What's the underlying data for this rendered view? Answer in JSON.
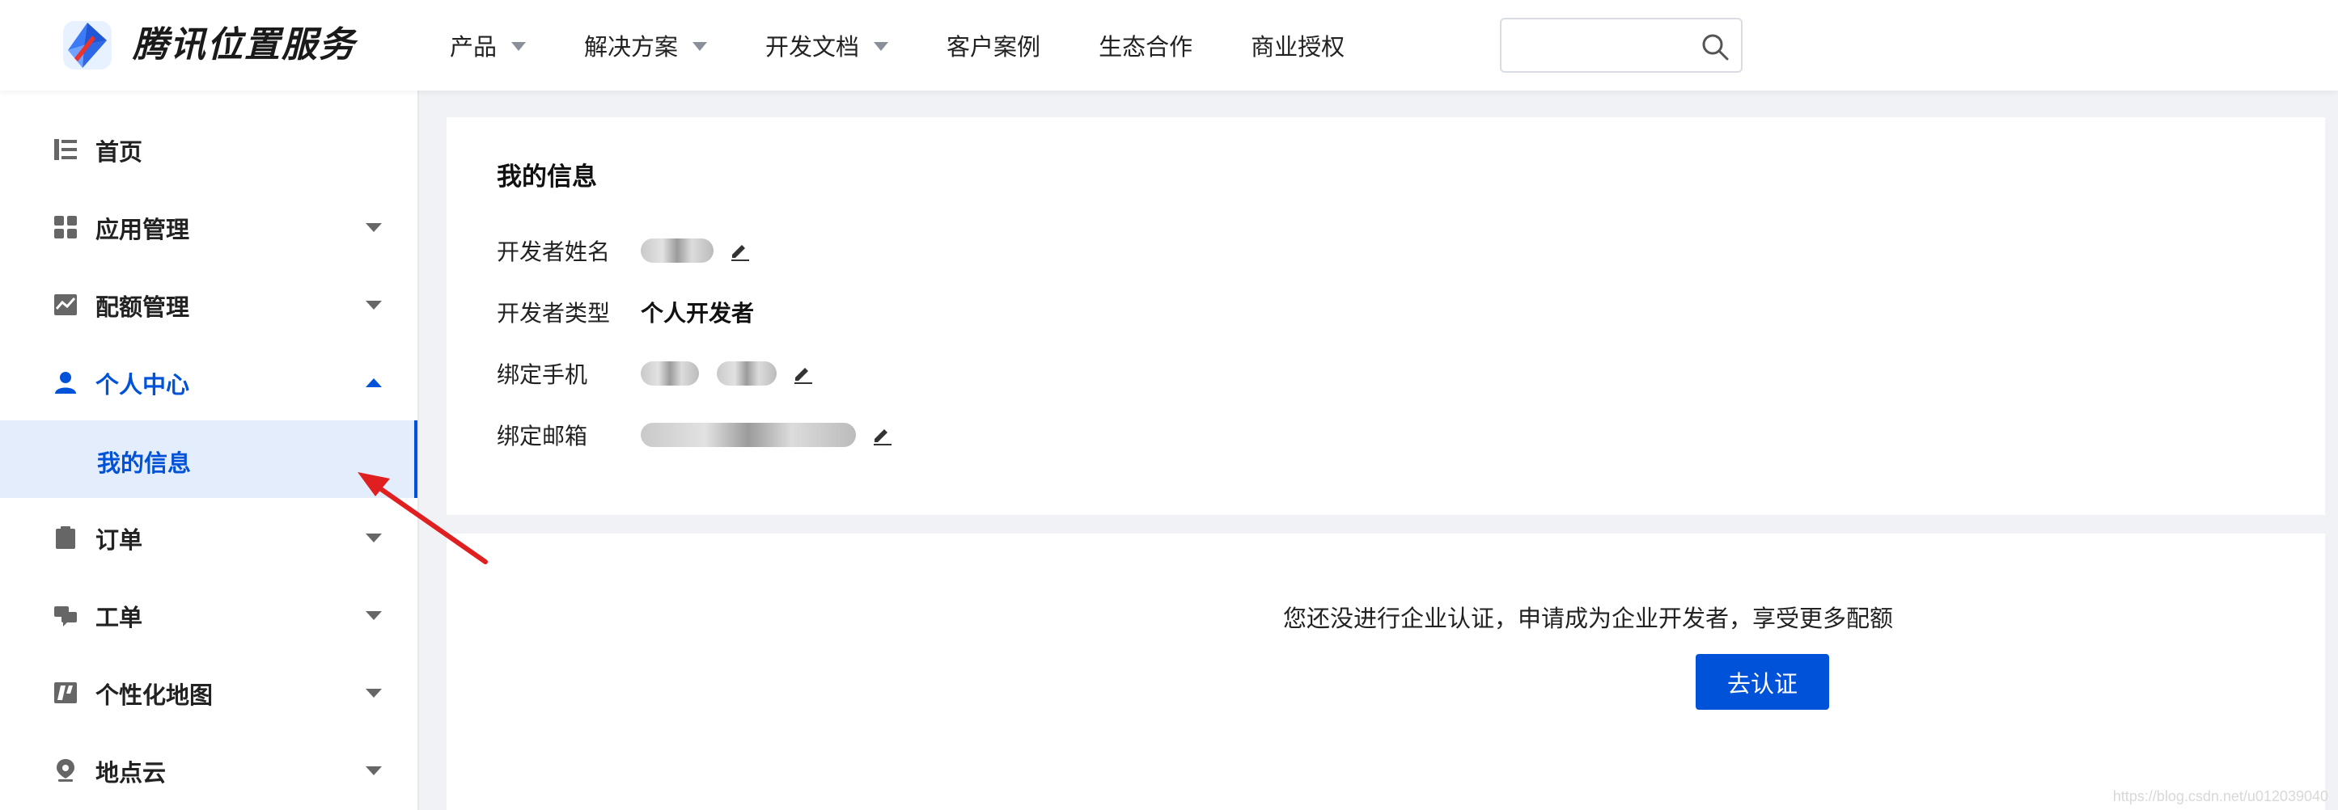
{
  "header": {
    "brand": "腾讯位置服务",
    "nav": [
      {
        "label": "产品",
        "dropdown": true
      },
      {
        "label": "解决方案",
        "dropdown": true
      },
      {
        "label": "开发文档",
        "dropdown": true
      },
      {
        "label": "客户案例",
        "dropdown": false
      },
      {
        "label": "生态合作",
        "dropdown": false
      },
      {
        "label": "商业授权",
        "dropdown": false
      }
    ],
    "search": {
      "placeholder": ""
    }
  },
  "sidebar": {
    "items": [
      {
        "label": "首页",
        "icon": "list-icon"
      },
      {
        "label": "应用管理",
        "icon": "grid-icon"
      },
      {
        "label": "配额管理",
        "icon": "chart-icon"
      },
      {
        "label": "个人中心",
        "icon": "user-icon"
      },
      {
        "label": "订单",
        "icon": "clipboard-icon"
      },
      {
        "label": "工单",
        "icon": "chat-icon"
      },
      {
        "label": "个性化地图",
        "icon": "custom-map-icon"
      },
      {
        "label": "地点云",
        "icon": "location-pin-icon"
      }
    ],
    "sub_item": "我的信息"
  },
  "card": {
    "title": "我的信息",
    "rows": [
      {
        "label": "开发者姓名",
        "value": "",
        "redacted": true,
        "editable": true
      },
      {
        "label": "开发者类型",
        "value": "个人开发者",
        "redacted": false,
        "editable": false
      },
      {
        "label": "绑定手机",
        "value": "",
        "redacted": true,
        "editable": true
      },
      {
        "label": "绑定邮箱",
        "value": "",
        "redacted": true,
        "editable": true
      }
    ]
  },
  "certify": {
    "notice": "您还没进行企业认证，申请成为企业开发者，享受更多配额",
    "button": "去认证"
  },
  "watermark": "https://blog.csdn.net/u012039040",
  "colors": {
    "accent": "#0052d9",
    "active_bg": "#e3edfc",
    "annotation": "#e02020"
  }
}
